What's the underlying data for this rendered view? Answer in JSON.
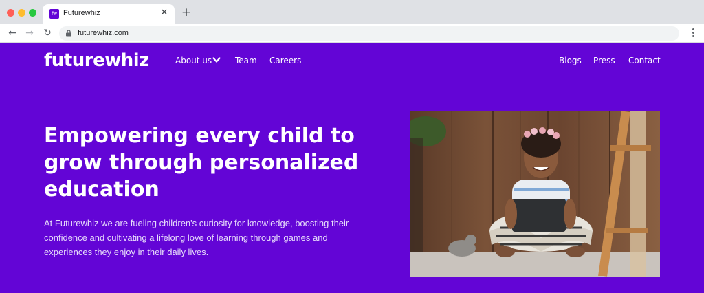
{
  "browser": {
    "tab_title": "Futurewhiz",
    "favicon_text": "fw",
    "close_icon": "close-icon",
    "new_tab_icon": "plus-icon",
    "url": "futurewhiz.com"
  },
  "site": {
    "logo": "futurewhiz",
    "nav_left": [
      "About us",
      "Team",
      "Careers"
    ],
    "nav_right": [
      "Blogs",
      "Press",
      "Contact"
    ]
  },
  "hero": {
    "headline": "Empowering every child to grow through personalized education",
    "subtext": "At Futurewhiz we are fueling children's curiosity for knowledge, boosting their confidence and cultivating a lifelong love of learning through games and experiences they enjoy in their daily lives."
  },
  "colors": {
    "brand_purple": "#6305d6",
    "browser_chrome": "#dfe1e5"
  }
}
